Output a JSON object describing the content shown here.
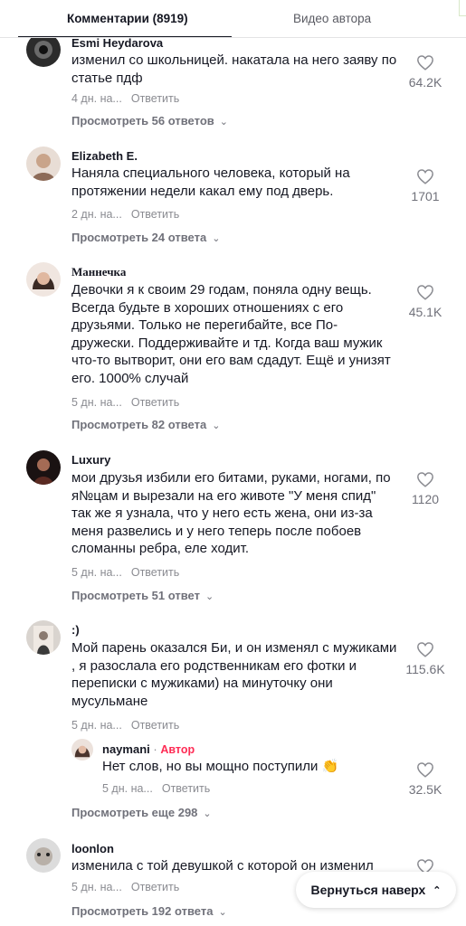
{
  "tabs": {
    "comments": "Комментарии (8919)",
    "videos": "Видео автора"
  },
  "comments": [
    {
      "username": "Esmi Heydarova",
      "text": "изменил со школьницей. накатала на него заяву по статье пдф",
      "time": "4 дн. на...",
      "reply": "Ответить",
      "likes": "64.2K",
      "view_replies": "Просмотреть 56 ответов"
    },
    {
      "username": "Elizabeth E.",
      "text": "Наняла специального человека, который на протяжении недели какал ему под дверь.",
      "time": "2 дн. на...",
      "reply": "Ответить",
      "likes": "1701",
      "view_replies": "Просмотреть 24 ответа"
    },
    {
      "username": "Маннечка",
      "text": "Девочки я к своим 29 годам, поняла одну вещь. Всегда будьте в хороших отношениях с его друзьями. Только не перегибайте, все По-дружески. Поддерживайте и тд. Когда ваш мужик что-то вытворит, они его вам сдадут. Ещё и унизят его. 1000% случай",
      "time": "5 дн. на...",
      "reply": "Ответить",
      "likes": "45.1K",
      "view_replies": "Просмотреть 82 ответа"
    },
    {
      "username": "Luxury",
      "text": "мои друзья избили его битами, руками, ногами, по я№цам и вырезали на его животе \"У меня спид\" так же я узнала, что у него есть жена, они из-за меня развелись и у него теперь после побоев сломанны ребра, еле ходит.",
      "time": "5 дн. на...",
      "reply": "Ответить",
      "likes": "1120",
      "view_replies": "Просмотреть 51 ответ"
    },
    {
      "username": ":)",
      "text": "Мой парень оказался Би, и он изменял с мужиками , я разослала его родственникам его фотки и переписки с мужиками) на минуточку они мусульмане",
      "time": "5 дн. на...",
      "reply": "Ответить",
      "likes": "115.6K",
      "reply_item": {
        "username": "naymani",
        "separator": "·",
        "badge": "Автор",
        "text": "Нет слов, но вы мощно поступили 👏",
        "time": "5 дн. на...",
        "reply": "Ответить",
        "likes": "32.5K"
      },
      "view_replies": "Просмотреть еще 298"
    },
    {
      "username": "loonlon",
      "text": "изменила с той девушкой с которой он изменил",
      "time": "5 дн. на...",
      "reply": "Ответить",
      "likes": "",
      "view_replies": "Просмотреть 192 ответа"
    }
  ],
  "back_to_top": "Вернуться наверх",
  "icons": {
    "like": "heart-outline-icon",
    "chevron": "chevron-down-icon",
    "back": "double-chevron-up-icon"
  },
  "colors": {
    "text": "#161823",
    "muted": "#8a8b91",
    "author_badge": "#fe2c55"
  }
}
